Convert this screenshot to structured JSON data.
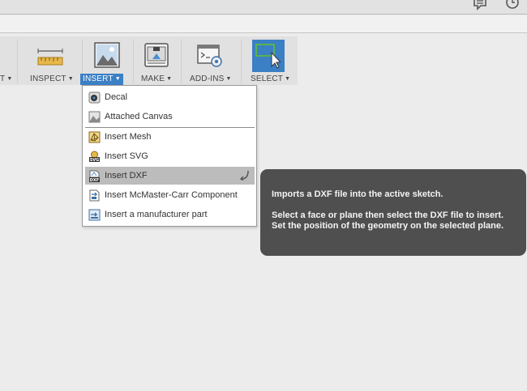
{
  "toolbar": {
    "partial_prev_label": "T",
    "groups": [
      {
        "label": "INSPECT",
        "icon": "measure-ruler-icon"
      },
      {
        "label": "INSERT",
        "icon": "insert-image-icon"
      },
      {
        "label": "MAKE",
        "icon": "3d-print-icon"
      },
      {
        "label": "ADD-INS",
        "icon": "scripts-addins-icon"
      },
      {
        "label": "SELECT",
        "icon": "select-arrow-icon"
      }
    ]
  },
  "topbar_icons": [
    "notifications-icon",
    "history-clock-icon"
  ],
  "insert_menu": {
    "items": [
      {
        "label": "Decal",
        "icon": "decal-icon"
      },
      {
        "label": "Attached Canvas",
        "icon": "canvas-icon"
      },
      {
        "label": "Insert Mesh",
        "icon": "mesh-icon"
      },
      {
        "label": "Insert SVG",
        "icon": "svg-file-icon"
      },
      {
        "label": "Insert DXF",
        "icon": "dxf-file-icon"
      },
      {
        "label": "Insert McMaster-Carr Component",
        "icon": "mcmaster-icon"
      },
      {
        "label": "Insert a manufacturer part",
        "icon": "manufacturer-part-icon"
      }
    ],
    "highlighted": "Insert DXF"
  },
  "tooltip": {
    "line1": "Imports a DXF file into the active sketch.",
    "line2": "Select a face or plane then select the DXF file to insert. Set the position of the geometry on the selected plane."
  },
  "colors": {
    "accent": "#3b7fc4",
    "tooltip_bg": "#4f4f4f",
    "highlight": "#bcbcbc"
  }
}
